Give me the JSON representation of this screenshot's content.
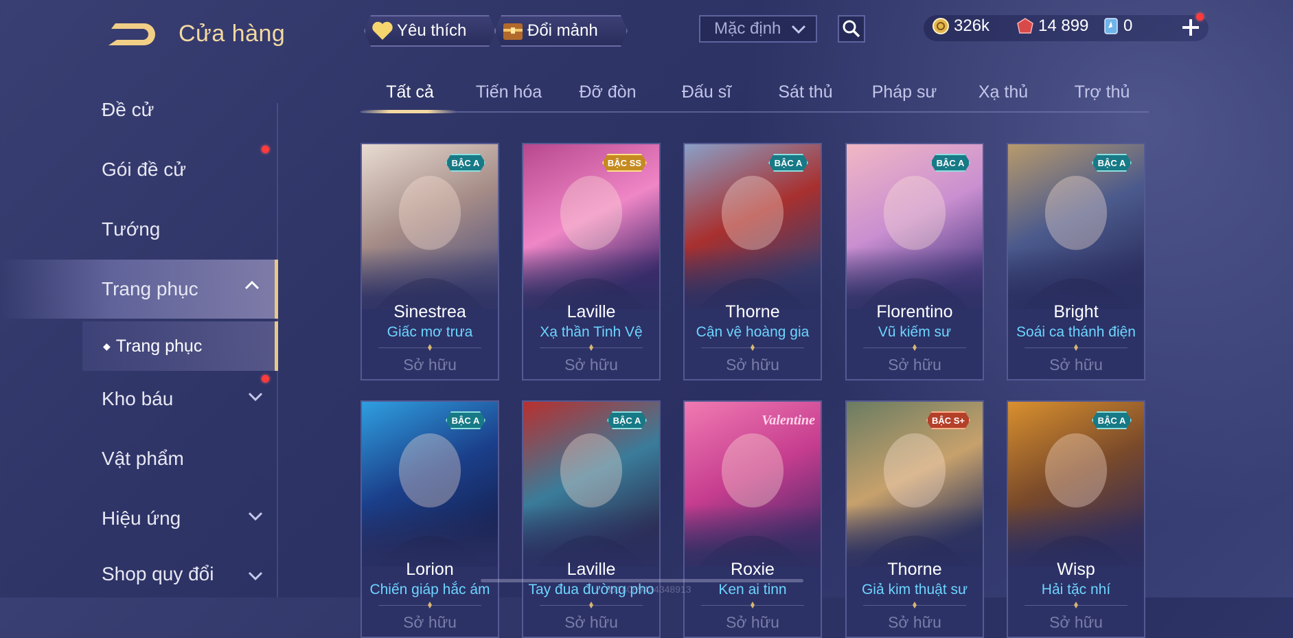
{
  "header": {
    "title": "Cửa hàng",
    "favorites_label": "Yêu thích",
    "exchange_label": "Đổi mảnh",
    "sort_value": "Mặc định"
  },
  "currency": {
    "gold": "326k",
    "vouchers": "14 899",
    "quan_huy": "0"
  },
  "sidebar": {
    "items": [
      {
        "label": "Đề cử"
      },
      {
        "label": "Gói đề cử"
      },
      {
        "label": "Tướng"
      },
      {
        "label": "Trang phục"
      },
      {
        "label": "Kho báu"
      },
      {
        "label": "Vật phẩm"
      },
      {
        "label": "Hiệu ứng"
      },
      {
        "label": "Shop quy đổi"
      }
    ],
    "sub_item": "Trang phục"
  },
  "tabs": [
    "Tất cả",
    "Tiến hóa",
    "Đỡ đòn",
    "Đấu sĩ",
    "Sát thủ",
    "Pháp sư",
    "Xạ thủ",
    "Trợ thủ"
  ],
  "owned_label": "Sở hữu",
  "cards": [
    {
      "hero": "Sinestrea",
      "skin": "Giấc mơ trưa",
      "tier": "BẬC A",
      "palette": [
        "#e8dbd2",
        "#a58c87",
        "#5e5a7e"
      ]
    },
    {
      "hero": "Laville",
      "skin": "Xạ thần Tinh Vệ",
      "tier": "BẬC SS",
      "palette": [
        "#b8488e",
        "#ef86c6",
        "#452a6e"
      ]
    },
    {
      "hero": "Thorne",
      "skin": "Cận vệ hoàng gia",
      "tier": "BẬC A",
      "palette": [
        "#8aa0c8",
        "#a8302f",
        "#3b3f6e"
      ]
    },
    {
      "hero": "Florentino",
      "skin": "Vũ kiếm sư",
      "tier": "BẬC A",
      "palette": [
        "#f1b7c4",
        "#c98fd0",
        "#57418a"
      ]
    },
    {
      "hero": "Bright",
      "skin": "Soái ca thánh điện",
      "tier": "BẬC A",
      "palette": [
        "#b89a6c",
        "#4b5a8c",
        "#2e3262"
      ]
    },
    {
      "hero": "Lorion",
      "skin": "Chiến giáp hắc ám",
      "tier": "BẬC A",
      "palette": [
        "#2f9fe0",
        "#1b3f8a",
        "#162253"
      ]
    },
    {
      "hero": "Laville",
      "skin": "Tay đua đường pho",
      "tier": "BẬC A",
      "palette": [
        "#b8302f",
        "#3a7c9a",
        "#2d2f52"
      ]
    },
    {
      "hero": "Roxie",
      "skin": "Ken ai tinn",
      "tier": "Valentine",
      "palette": [
        "#f07ab2",
        "#c63d8f",
        "#5a2b6e"
      ]
    },
    {
      "hero": "Thorne",
      "skin": "Giả kim thuật sư",
      "tier": "BẬC S+",
      "palette": [
        "#6a7c62",
        "#c7a16c",
        "#32385e"
      ]
    },
    {
      "hero": "Wisp",
      "skin": "Hải tặc nhí",
      "tier": "BẬC A",
      "palette": [
        "#d9902e",
        "#7a4a2a",
        "#3b2f55"
      ]
    }
  ],
  "watermark": "3514089434348913"
}
